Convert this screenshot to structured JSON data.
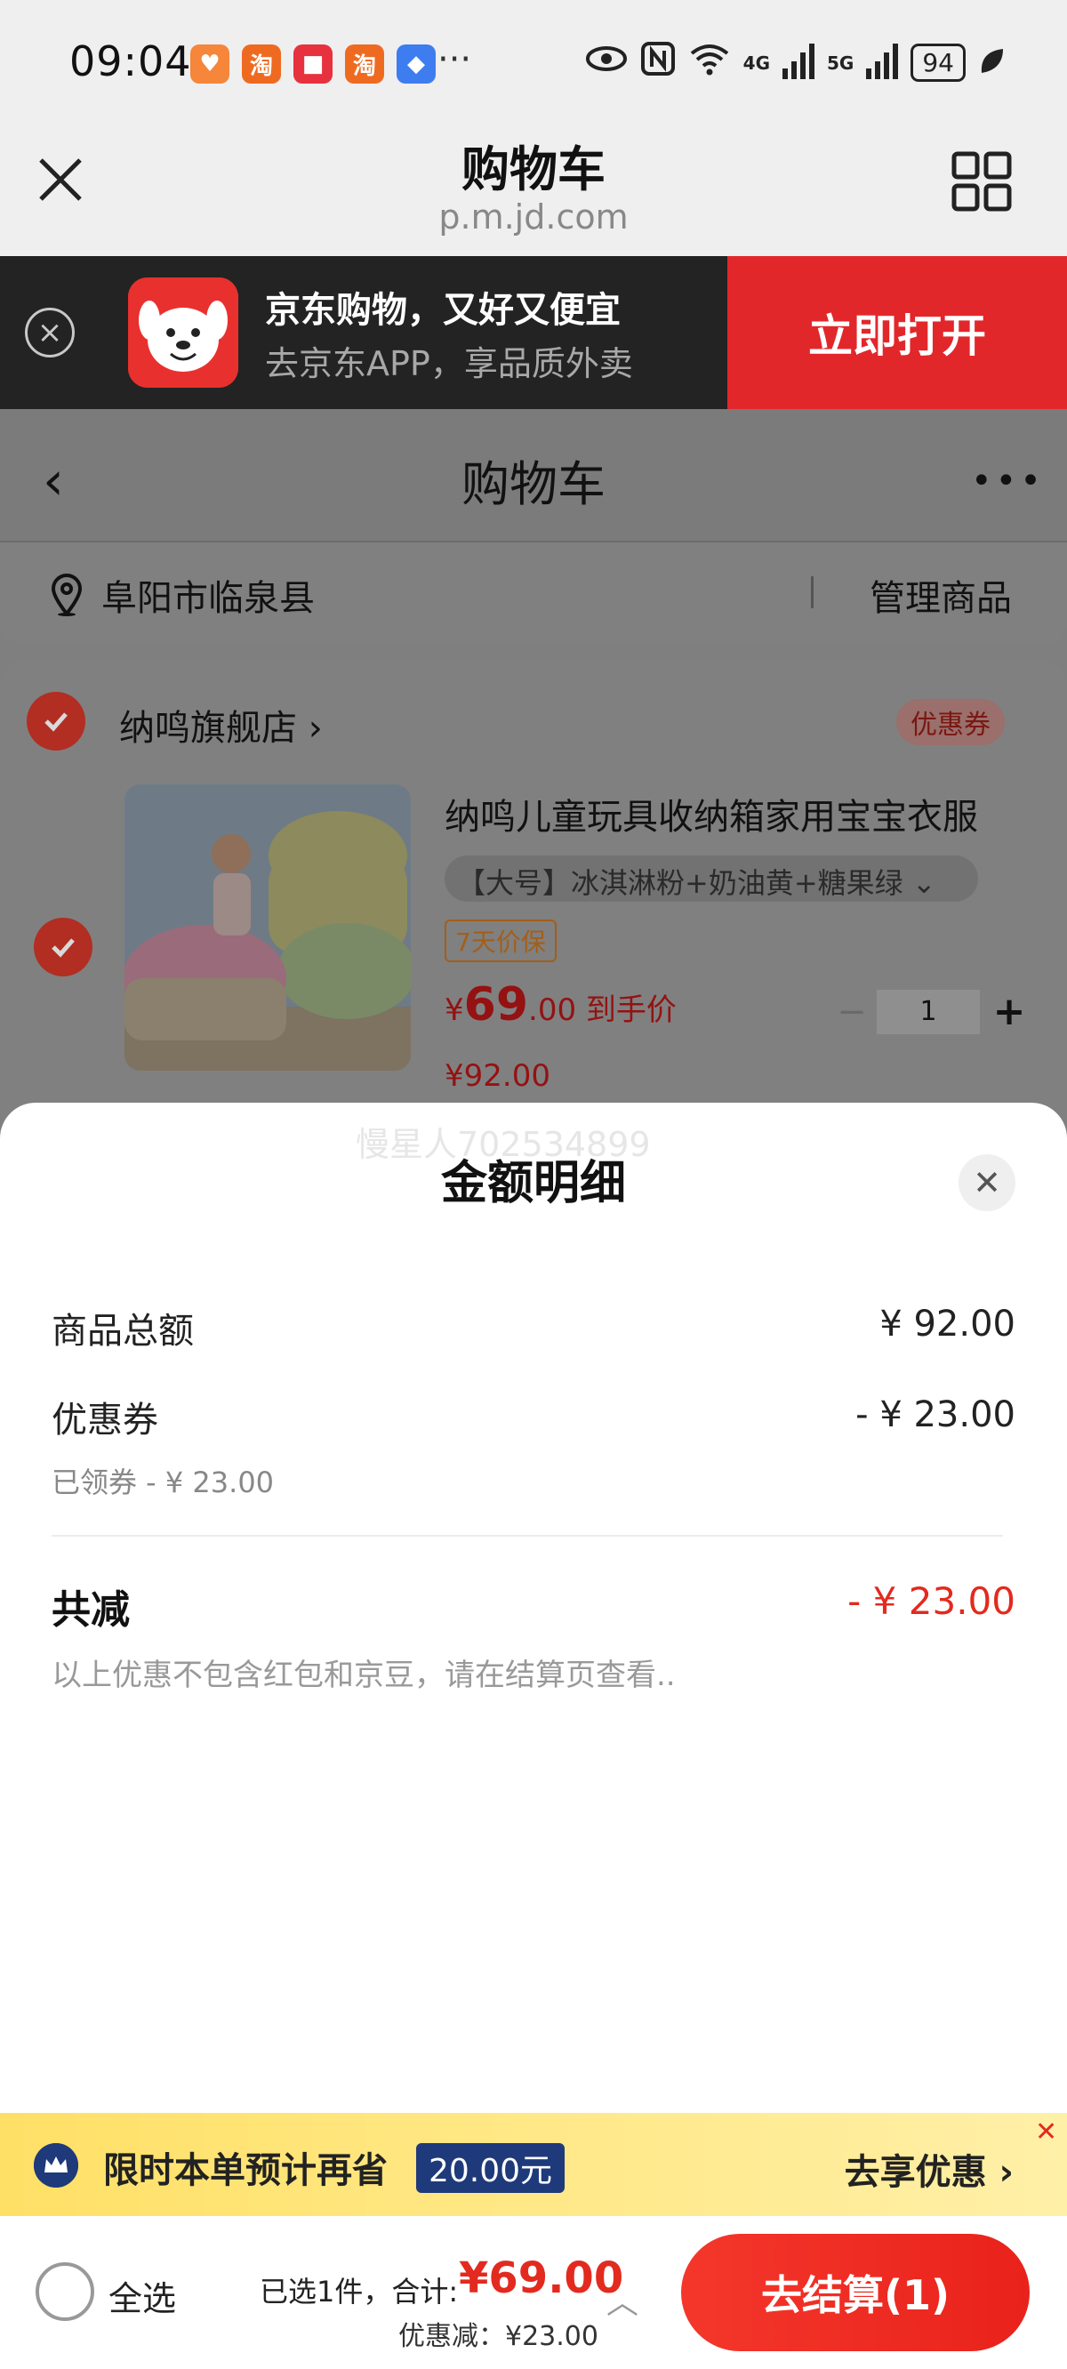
{
  "status_bar": {
    "time": "09:04",
    "app_icons": [
      {
        "name": "app-icon-1",
        "glyph": "♥",
        "color": "#f5863a"
      },
      {
        "name": "taobao-icon",
        "glyph": "淘",
        "color": "#ef6a21"
      },
      {
        "name": "app-icon-3",
        "glyph": "■",
        "color": "#e8313f"
      },
      {
        "name": "taobao-flash-icon",
        "glyph": "淘",
        "color": "#ef6a21"
      },
      {
        "name": "app-icon-5",
        "glyph": "◆",
        "color": "#3d7df0"
      }
    ],
    "more": "···",
    "net_4g": "4G",
    "net_5g": "5G",
    "battery": "94"
  },
  "browser": {
    "title": "购物车",
    "url": "p.m.jd.com"
  },
  "app_banner": {
    "line1": "京东购物，又好又便宜",
    "line2": "去京东APP，享品质外卖",
    "open_label": "立即打开"
  },
  "cart_nav": {
    "back": "‹",
    "title": "购物车",
    "more": "•••"
  },
  "location": {
    "address": "阜阳市临泉县",
    "manage_label": "管理商品"
  },
  "shop": {
    "name": "纳鸣旗舰店 ›",
    "coupon_label": "优惠券",
    "product": {
      "name": "纳鸣儿童玩具收纳箱家用宝宝衣服",
      "spec": "【大号】冰淇淋粉+奶油黄+糖果绿 ⌄",
      "tag": "7天价保",
      "price_symbol": "¥",
      "price_int": "69",
      "price_dec": ".00",
      "price_suffix": " 到手价",
      "original_price": "¥92.00",
      "quantity": "1",
      "minus": "−",
      "plus": "+"
    }
  },
  "sheet": {
    "watermark": "慢星人702534899",
    "title": "金额明细",
    "close": "✕",
    "rows": {
      "goods_total_label": "商品总额",
      "goods_total_value": "¥ 92.00",
      "coupon_label": "优惠券",
      "coupon_value": "- ¥ 23.00",
      "coupon_sub": "已领券 - ¥ 23.00"
    },
    "total_label": "共减",
    "total_value": "- ¥ 23.00",
    "note": "以上优惠不包含红包和京豆，请在结算页查看.."
  },
  "promo": {
    "text": "限时本单预计再省",
    "amount": "20.00元",
    "cta": "去享优惠 ›",
    "close": "✕"
  },
  "checkout": {
    "select_all": "全选",
    "selected_text": "已选1件，合计:",
    "total": "¥69.00",
    "discount": "优惠减：¥23.00",
    "caret": "︿",
    "button": "去结算(1)"
  },
  "colors": {
    "jd_red": "#e2272b",
    "price_red": "#e32a1f",
    "promo_yellow": "#ffe066",
    "promo_navy": "#1f3a7a"
  }
}
